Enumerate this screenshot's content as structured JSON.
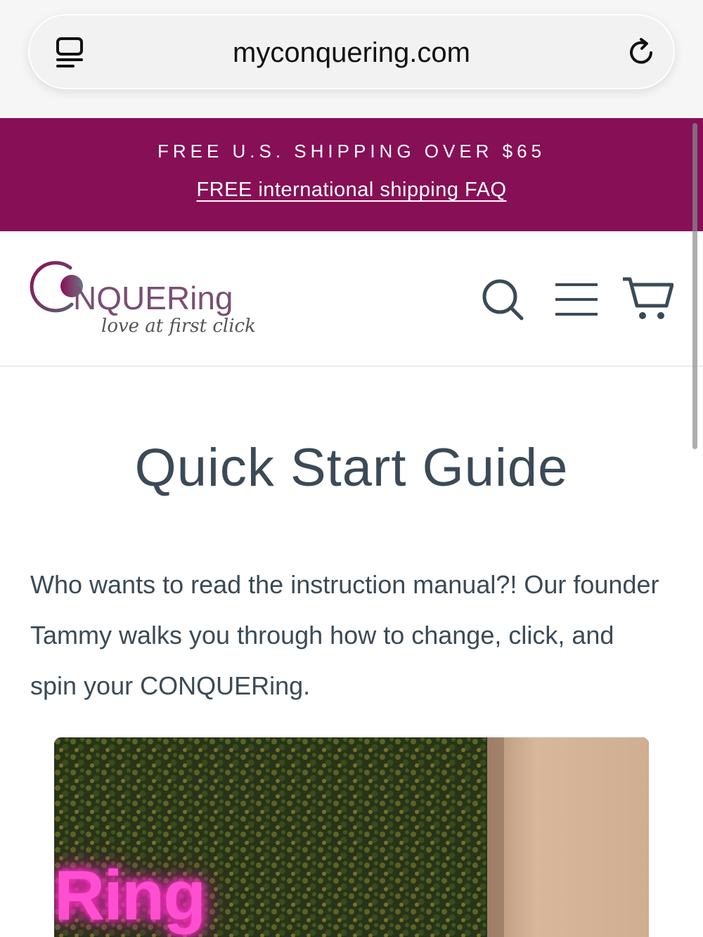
{
  "browser": {
    "url": "myconquering.com",
    "reader_icon": "reader-mode-icon",
    "reload_icon": "reload-icon"
  },
  "announcement": {
    "line1": "FREE U.S. SHIPPING OVER $65",
    "line2": "FREE international shipping FAQ",
    "background": "#870f56"
  },
  "header": {
    "logo_word": "NQUERing",
    "logo_tagline": "love at first click",
    "icons": [
      "search-icon",
      "menu-icon",
      "cart-icon"
    ]
  },
  "main": {
    "title": "Quick Start Guide",
    "intro": "Who wants to read the instruction manual?! Our founder Tammy walks you through how to change, click, and spin your CONQUERing.",
    "video": {
      "neon_text": "Ring"
    }
  },
  "colors": {
    "brand": "#870f56",
    "text": "#3b4a56",
    "logo": "#7a4f73"
  }
}
